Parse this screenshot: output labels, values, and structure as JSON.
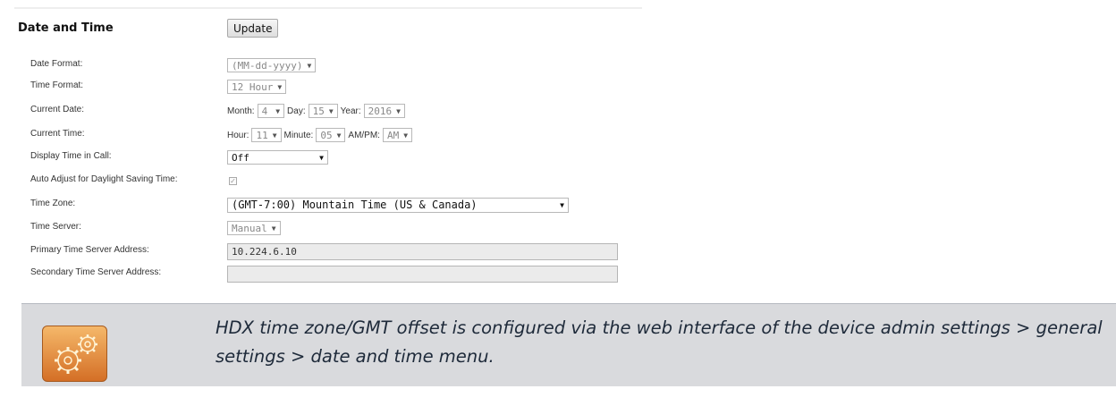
{
  "section": {
    "title": "Date and Time",
    "update_label": "Update"
  },
  "fields": {
    "date_format": {
      "label": "Date Format:",
      "value": "(MM-dd-yyyy)"
    },
    "time_format": {
      "label": "Time Format:",
      "value": "12 Hour"
    },
    "current_date": {
      "label": "Current Date:",
      "month_label": "Month:",
      "month": "4",
      "day_label": "Day:",
      "day": "15",
      "year_label": "Year:",
      "year": "2016"
    },
    "current_time": {
      "label": "Current Time:",
      "hour_label": "Hour:",
      "hour": "11",
      "minute_label": "Minute:",
      "minute": "05",
      "ampm_label": "AM/PM:",
      "ampm": "AM"
    },
    "display_time_in_call": {
      "label": "Display Time in Call:",
      "value": "Off"
    },
    "auto_adjust_dst": {
      "label": "Auto Adjust for Daylight Saving Time:",
      "checked": true,
      "mark": "✓"
    },
    "time_zone": {
      "label": "Time Zone:",
      "value": "(GMT-7:00) Mountain Time (US & Canada)"
    },
    "time_server": {
      "label": "Time Server:",
      "value": "Manual"
    },
    "primary_time_server": {
      "label": "Primary Time Server Address:",
      "value": "10.224.6.10"
    },
    "secondary_time_server": {
      "label": "Secondary Time Server Address:",
      "value": ""
    }
  },
  "dropdown_arrow": "▼",
  "note": {
    "icon": "gears-icon",
    "text": "HDX time zone/GMT offset is configured via the web interface of the device admin settings > general settings > date and time menu."
  },
  "colors": {
    "note_bg": "#d9dadd",
    "icon_orange": "#e08a3a"
  }
}
